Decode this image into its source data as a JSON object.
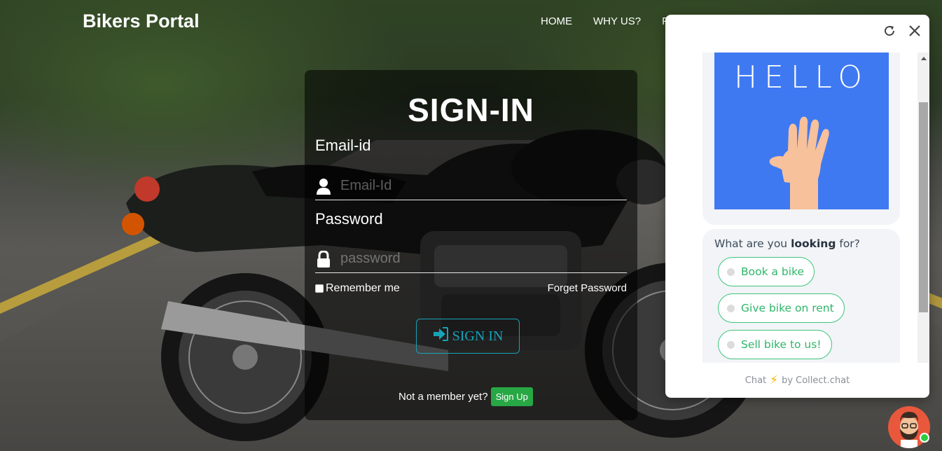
{
  "navbar": {
    "brand": "Bikers Portal",
    "links": [
      "HOME",
      "WHY US?",
      "P"
    ]
  },
  "signin": {
    "title": "SIGN-IN",
    "email_label": "Email-id",
    "email_placeholder": "Email-Id",
    "password_label": "Password",
    "password_placeholder": "password",
    "remember_label": "Remember me",
    "forget_label": "Forget Password",
    "signin_button": "SIGN IN",
    "not_member_text": "Not a member yet?",
    "signup_button": "Sign Up"
  },
  "chat": {
    "image_text": "HELLO",
    "question_pre": "What are you ",
    "question_bold": "looking",
    "question_post": " for?",
    "options": [
      "Book a bike",
      "Give bike on rent",
      "Sell bike to us!"
    ],
    "footer_pre": "Chat",
    "footer_post": "by Collect.chat"
  },
  "colors": {
    "accent": "#17a2b8",
    "signup": "#28a745",
    "chat_option": "#3cc67a",
    "hello_bg": "#3f79f2"
  }
}
